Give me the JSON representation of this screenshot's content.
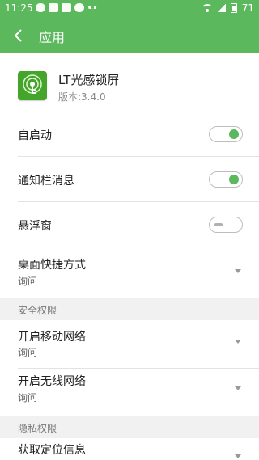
{
  "status_bar": {
    "time": "11:25",
    "battery": "71",
    "icons": [
      "chat-icon",
      "image-icon",
      "mail-icon",
      "cloud-icon",
      "more-icon",
      "wifi-icon",
      "signal-icon",
      "battery-icon"
    ]
  },
  "toolbar": {
    "title": "应用",
    "back_icon": "back-arrow-icon"
  },
  "app": {
    "name": "LT光感锁屏",
    "version": "版本:3.4.0",
    "icon": "lock-key-icon"
  },
  "settings": {
    "autostart": {
      "label": "自启动",
      "state": "on"
    },
    "notifications": {
      "label": "通知栏消息",
      "state": "on"
    },
    "floating_window": {
      "label": "悬浮窗",
      "state": "off"
    },
    "desktop_shortcut": {
      "label": "桌面快捷方式",
      "value": "询问"
    }
  },
  "security": {
    "header": "安全权限",
    "mobile_network": {
      "label": "开启移动网络",
      "value": "询问"
    },
    "wifi_network": {
      "label": "开启无线网络",
      "value": "询问"
    }
  },
  "privacy": {
    "header": "隐私权限",
    "location": {
      "label": "获取定位信息"
    }
  },
  "colors": {
    "accent": "#5cb85c",
    "app_icon": "#44a52a",
    "section_bg": "#f1f1f1"
  }
}
